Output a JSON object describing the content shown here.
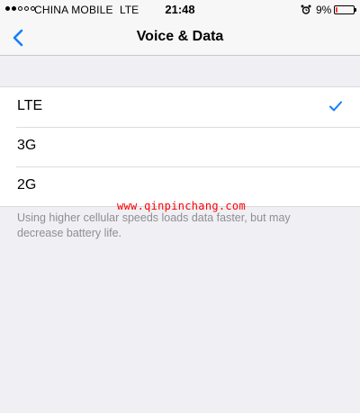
{
  "status_bar": {
    "carrier": "CHINA MOBILE",
    "network": "LTE",
    "time": "21:48",
    "battery_percent_label": "9%",
    "battery_level": 0.09,
    "battery_color": "#ff3b30",
    "alarm_icon": "alarm-clock-icon"
  },
  "nav": {
    "title": "Voice & Data",
    "back_icon": "chevron-left-icon",
    "accent_color": "#157efb"
  },
  "options": [
    {
      "label": "LTE",
      "selected": true
    },
    {
      "label": "3G",
      "selected": false
    },
    {
      "label": "2G",
      "selected": false
    }
  ],
  "watermark": "www.qinpinchang.com",
  "footer_note": "Using higher cellular speeds loads data faster, but may decrease battery life."
}
